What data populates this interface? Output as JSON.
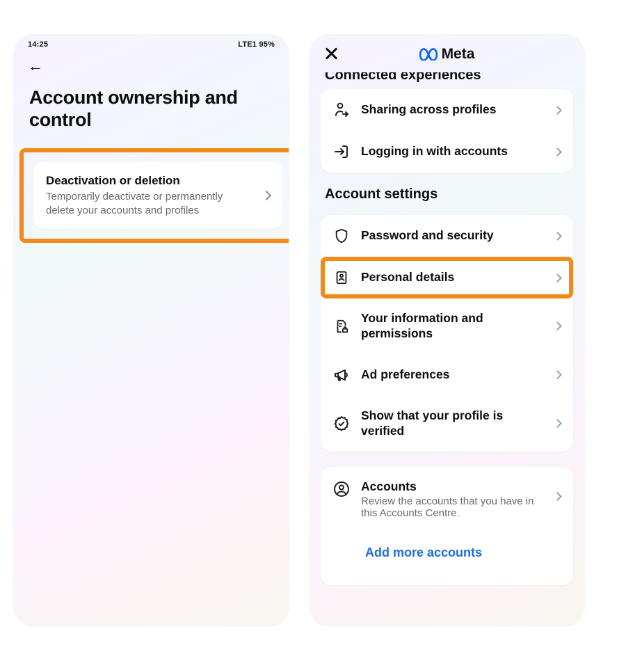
{
  "left": {
    "status_time": "14:25",
    "status_right": "LTE1 95%",
    "page_title": "Account ownership and control",
    "deactivation": {
      "title": "Deactivation or deletion",
      "sub": "Temporarily deactivate or permanently delete your accounts and profiles"
    }
  },
  "right": {
    "brand": "Meta",
    "section_conn": "Connected experiences",
    "items_conn": [
      {
        "label": "Sharing across profiles"
      },
      {
        "label": "Logging in with accounts"
      }
    ],
    "section_settings": "Account settings",
    "items_settings": [
      {
        "label": "Password and security"
      },
      {
        "label": "Personal details"
      },
      {
        "label": "Your information and permissions"
      },
      {
        "label": "Ad preferences"
      },
      {
        "label": "Show that your profile is verified"
      }
    ],
    "accounts": {
      "title": "Accounts",
      "sub": "Review the accounts that you have in this Accounts Centre."
    },
    "add_more": "Add more accounts"
  }
}
